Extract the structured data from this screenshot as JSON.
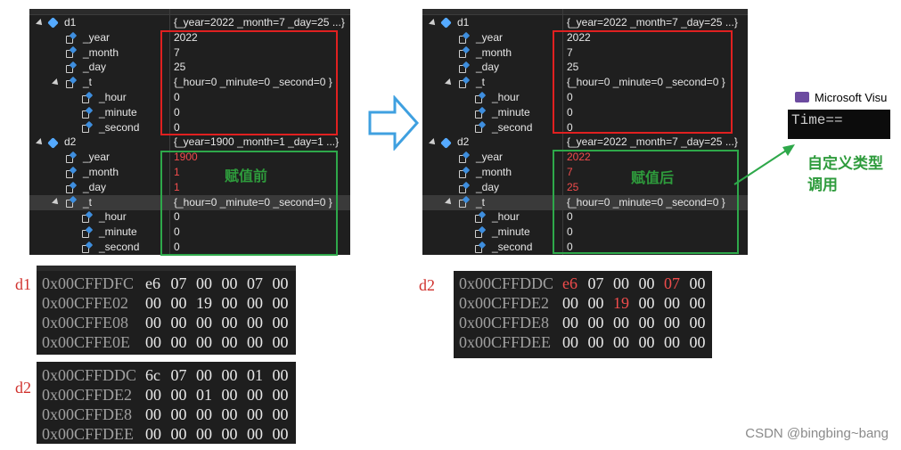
{
  "watch_before": {
    "rows": [
      {
        "name": "d1",
        "value": "{_year=2022 _month=7 _day=25 ...}"
      },
      {
        "name": "_year",
        "value": "2022"
      },
      {
        "name": "_month",
        "value": "7"
      },
      {
        "name": "_day",
        "value": "25"
      },
      {
        "name": "_t",
        "value": "{_hour=0 _minute=0 _second=0 }"
      },
      {
        "name": "_hour",
        "value": "0"
      },
      {
        "name": "_minute",
        "value": "0"
      },
      {
        "name": "_second",
        "value": "0"
      },
      {
        "name": "d2",
        "value": "{_year=1900 _month=1 _day=1 ...}"
      },
      {
        "name": "_year",
        "value": "1900"
      },
      {
        "name": "_month",
        "value": "1"
      },
      {
        "name": "_day",
        "value": "1"
      },
      {
        "name": "_t",
        "value": "{_hour=0 _minute=0 _second=0 }"
      },
      {
        "name": "_hour",
        "value": "0"
      },
      {
        "name": "_minute",
        "value": "0"
      },
      {
        "name": "_second",
        "value": "0"
      }
    ],
    "annotation": "赋值前"
  },
  "watch_after": {
    "rows": [
      {
        "name": "d1",
        "value": "{_year=2022 _month=7 _day=25 ...}"
      },
      {
        "name": "_year",
        "value": "2022"
      },
      {
        "name": "_month",
        "value": "7"
      },
      {
        "name": "_day",
        "value": "25"
      },
      {
        "name": "_t",
        "value": "{_hour=0 _minute=0 _second=0 }"
      },
      {
        "name": "_hour",
        "value": "0"
      },
      {
        "name": "_minute",
        "value": "0"
      },
      {
        "name": "_second",
        "value": "0"
      },
      {
        "name": "d2",
        "value": "{_year=2022 _month=7 _day=25 ...}"
      },
      {
        "name": "_year",
        "value": "2022"
      },
      {
        "name": "_month",
        "value": "7"
      },
      {
        "name": "_day",
        "value": "25"
      },
      {
        "name": "_t",
        "value": "{_hour=0 _minute=0 _second=0 }"
      },
      {
        "name": "_hour",
        "value": "0"
      },
      {
        "name": "_minute",
        "value": "0"
      },
      {
        "name": "_second",
        "value": "0"
      }
    ],
    "annotation": "赋值后"
  },
  "mem_d1": {
    "label": "d1",
    "rows": [
      {
        "addr": "0x00CFFDFC",
        "bytes": [
          "e6",
          "07",
          "00",
          "00",
          "07",
          "00"
        ]
      },
      {
        "addr": "0x00CFFE02",
        "bytes": [
          "00",
          "00",
          "19",
          "00",
          "00",
          "00"
        ]
      },
      {
        "addr": "0x00CFFE08",
        "bytes": [
          "00",
          "00",
          "00",
          "00",
          "00",
          "00"
        ]
      },
      {
        "addr": "0x00CFFE0E",
        "bytes": [
          "00",
          "00",
          "00",
          "00",
          "00",
          "00"
        ]
      }
    ]
  },
  "mem_d2_before": {
    "label": "d2",
    "rows": [
      {
        "addr": "0x00CFFDDC",
        "bytes": [
          "6c",
          "07",
          "00",
          "00",
          "01",
          "00"
        ]
      },
      {
        "addr": "0x00CFFDE2",
        "bytes": [
          "00",
          "00",
          "01",
          "00",
          "00",
          "00"
        ]
      },
      {
        "addr": "0x00CFFDE8",
        "bytes": [
          "00",
          "00",
          "00",
          "00",
          "00",
          "00"
        ]
      },
      {
        "addr": "0x00CFFDEE",
        "bytes": [
          "00",
          "00",
          "00",
          "00",
          "00",
          "00"
        ]
      }
    ]
  },
  "mem_d2_after": {
    "label": "d2",
    "rows": [
      {
        "addr": "0x00CFFDDC",
        "bytes": [
          "e6",
          "07",
          "00",
          "00",
          "07",
          "00"
        ]
      },
      {
        "addr": "0x00CFFDE2",
        "bytes": [
          "00",
          "00",
          "19",
          "00",
          "00",
          "00"
        ]
      },
      {
        "addr": "0x00CFFDE8",
        "bytes": [
          "00",
          "00",
          "00",
          "00",
          "00",
          "00"
        ]
      },
      {
        "addr": "0x00CFFDEE",
        "bytes": [
          "00",
          "00",
          "00",
          "00",
          "00",
          "00"
        ]
      }
    ]
  },
  "console": {
    "title": "Microsoft Visu",
    "text": "Time=="
  },
  "side_annotation": {
    "line1": "自定义类型",
    "line2": "调用"
  },
  "watermark": "CSDN @bingbing~bang",
  "colors": {
    "red_box": "#e02020",
    "green_box": "#2ea84a",
    "arrow": "#3fa0e0",
    "changed_value": "#f14c4c"
  }
}
